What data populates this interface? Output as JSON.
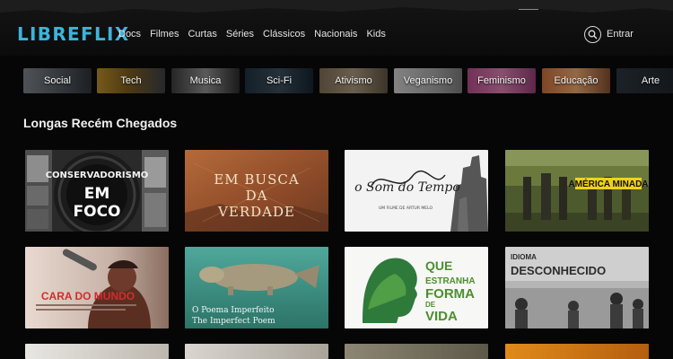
{
  "brand": {
    "logo": "LIBREFLIX",
    "color": "#3cb4dc"
  },
  "nav": {
    "items": [
      "Docs",
      "Filmes",
      "Curtas",
      "Séries",
      "Clássicos",
      "Nacionais",
      "Kids"
    ]
  },
  "header": {
    "login_label": "Entrar",
    "search_icon": "search-icon"
  },
  "categories": [
    "Social",
    "Tech",
    "Musica",
    "Sci-Fi",
    "Ativismo",
    "Veganismo",
    "Feminismo",
    "Educação",
    "Arte"
  ],
  "section": {
    "title": "Longas Recém Chegados"
  },
  "movies": [
    {
      "title_lines": [
        "CONSERVADORISMO",
        "EM",
        "FOCO"
      ]
    },
    {
      "title_lines": [
        "EM BUSCA",
        "DA",
        "VERDADE"
      ]
    },
    {
      "title_lines": [
        "o Som do Tempo"
      ],
      "credit": "UM FILME DE ARTUR MELO"
    },
    {
      "title_lines": [
        "AMÉRICA MINADA"
      ]
    },
    {
      "title_lines": [
        "CARA DO MUNDO"
      ]
    },
    {
      "title_lines": [
        "O Poema Imperfeito",
        "The Imperfect Poem"
      ]
    },
    {
      "title_lines": [
        "QUE",
        "ESTRANHA",
        "FORMA",
        "DE",
        "VIDA"
      ]
    },
    {
      "title_lines": [
        "IDIOMA",
        "DESCONHECIDO"
      ]
    }
  ]
}
